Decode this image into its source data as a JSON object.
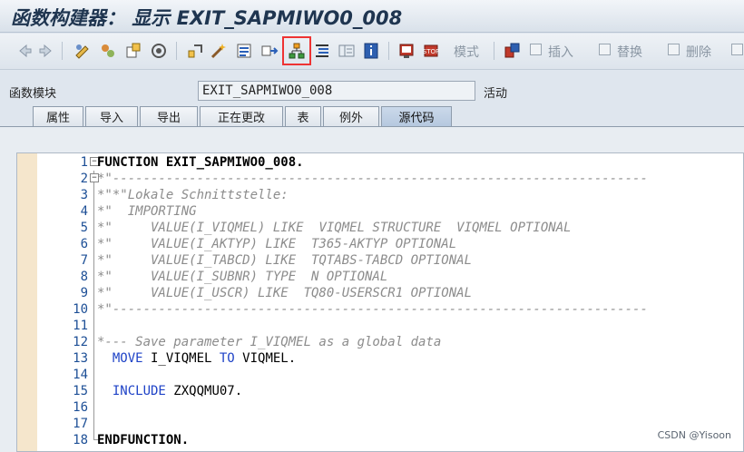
{
  "window": {
    "title": "函数构建器： 显示 EXIT_SAPMIWO0_008"
  },
  "toolbar": {
    "icons": [
      "back-arrow-icon",
      "forward-arrow-icon",
      "display-change-icon",
      "other-object-icon",
      "activate-icon",
      "check-icon",
      "where-used-icon",
      "test-icon",
      "display-object-list-icon",
      "navigation-window-icon",
      "hierarchy-icon",
      "pretty-printer-icon",
      "pattern-icon",
      "info-icon",
      "find-icon",
      "stop-icon"
    ],
    "mode_label": "模式",
    "insert_label": "插入",
    "replace_label": "替换",
    "delete_label": "删除"
  },
  "function_module": {
    "label": "函数模块",
    "value": "EXIT_SAPMIWO0_008",
    "status": "活动"
  },
  "tabs": [
    "属性",
    "导入",
    "导出",
    "正在更改",
    "表",
    "例外",
    "源代码"
  ],
  "active_tab": "源代码",
  "editor": {
    "lines": [
      {
        "n": "1",
        "text": "FUNCTION EXIT_SAPMIWO0_008."
      },
      {
        "n": "2",
        "text": "*\"----------------------------------------------------------------------"
      },
      {
        "n": "3",
        "text": "*\"*\"Lokale Schnittstelle:"
      },
      {
        "n": "4",
        "text": "*\"  IMPORTING"
      },
      {
        "n": "5",
        "text": "*\"     VALUE(I_VIQMEL) LIKE  VIQMEL STRUCTURE  VIQMEL OPTIONAL"
      },
      {
        "n": "6",
        "text": "*\"     VALUE(I_AKTYP) LIKE  T365-AKTYP OPTIONAL"
      },
      {
        "n": "7",
        "text": "*\"     VALUE(I_TABCD) LIKE  TQTABS-TABCD OPTIONAL"
      },
      {
        "n": "8",
        "text": "*\"     VALUE(I_SUBNR) TYPE  N OPTIONAL"
      },
      {
        "n": "9",
        "text": "*\"     VALUE(I_USCR) LIKE  TQ80-USERSCR1 OPTIONAL"
      },
      {
        "n": "10",
        "text": "*\"----------------------------------------------------------------------"
      },
      {
        "n": "11",
        "text": ""
      },
      {
        "n": "12",
        "text": "*--- Save parameter I_VIQMEL as a global data"
      },
      {
        "n": "13",
        "text": "  MOVE I_VIQMEL TO VIQMEL."
      },
      {
        "n": "14",
        "text": ""
      },
      {
        "n": "15",
        "text": "  INCLUDE ZXQQMU07."
      },
      {
        "n": "16",
        "text": ""
      },
      {
        "n": "17",
        "text": ""
      },
      {
        "n": "18",
        "text": "ENDFUNCTION."
      }
    ]
  },
  "watermark": "CSDN @Yisoon"
}
